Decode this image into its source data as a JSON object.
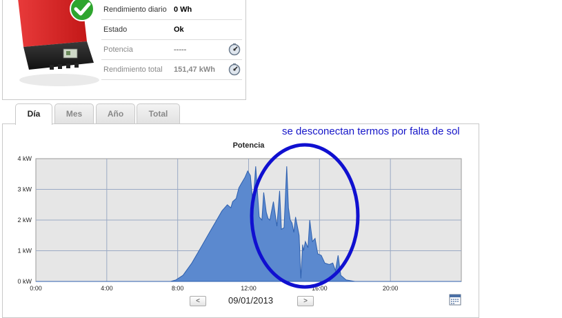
{
  "info": {
    "rows": [
      {
        "label": "Rendimiento diario",
        "value": "0  Wh"
      },
      {
        "label": "Estado",
        "value": "Ok"
      },
      {
        "label": "Potencia",
        "value": "-----"
      },
      {
        "label": "Rendimiento total",
        "value": "151,47  kWh"
      }
    ],
    "inverter_image": "red-inverter-with-green-check"
  },
  "tabs": [
    {
      "label": "Día",
      "active": true
    },
    {
      "label": "Mes",
      "active": false
    },
    {
      "label": "Año",
      "active": false
    },
    {
      "label": "Total",
      "active": false
    }
  ],
  "annotation": "se desconectan termos por falta de sol",
  "navigation": {
    "prev_label": "<",
    "next_label": ">",
    "date": "09/01/2013"
  },
  "colors": {
    "fill": "#5b89cf",
    "stroke": "#2d5fae",
    "plot_bg": "#e6e6e6",
    "grid": "#9aa9c4",
    "annotation": "#1515c8"
  },
  "chart_data": {
    "type": "area",
    "title": "Potencia",
    "xlabel": "",
    "ylabel": "",
    "x_ticks": [
      "0:00",
      "4:00",
      "8:00",
      "12:00",
      "16:00",
      "20:00"
    ],
    "y_ticks": [
      "0 kW",
      "1 kW",
      "2 kW",
      "3 kW",
      "4 kW"
    ],
    "xlim": [
      0,
      24
    ],
    "ylim": [
      0,
      4
    ],
    "grid": true,
    "series": [
      {
        "x": [
          0,
          7.6,
          7.9,
          8.3,
          8.8,
          9.3,
          9.8,
          10.2,
          10.5,
          10.8,
          11.0,
          11.1,
          11.3,
          11.45,
          11.6,
          11.8,
          11.95,
          12.1,
          12.25,
          12.4,
          12.5,
          12.6,
          12.75,
          12.85,
          13.0,
          13.1,
          13.2,
          13.4,
          13.6,
          13.75,
          13.85,
          14.0,
          14.15,
          14.25,
          14.35,
          14.45,
          14.55,
          14.65,
          14.75,
          14.85,
          14.95,
          15.05,
          15.1,
          15.2,
          15.35,
          15.45,
          15.6,
          15.75,
          15.9,
          16.1,
          16.3,
          16.55,
          16.75,
          16.9,
          17.05,
          17.2,
          17.5,
          17.8,
          18.0,
          24
        ],
        "values": [
          0,
          0,
          0.05,
          0.2,
          0.6,
          1.1,
          1.6,
          2.0,
          2.3,
          2.5,
          2.4,
          2.6,
          2.7,
          3.05,
          3.2,
          3.4,
          3.6,
          3.45,
          2.5,
          3.75,
          2.9,
          2.1,
          2.0,
          2.9,
          2.25,
          2.05,
          2.0,
          2.6,
          1.8,
          2.95,
          1.7,
          1.75,
          3.75,
          2.4,
          2.0,
          1.9,
          1.6,
          2.1,
          1.8,
          1.5,
          0.1,
          1.2,
          1.0,
          1.3,
          1.1,
          2.0,
          1.3,
          1.4,
          0.9,
          0.85,
          0.6,
          0.55,
          0.6,
          0.35,
          0.85,
          0.2,
          0.05,
          0.02,
          0,
          0
        ]
      }
    ]
  }
}
